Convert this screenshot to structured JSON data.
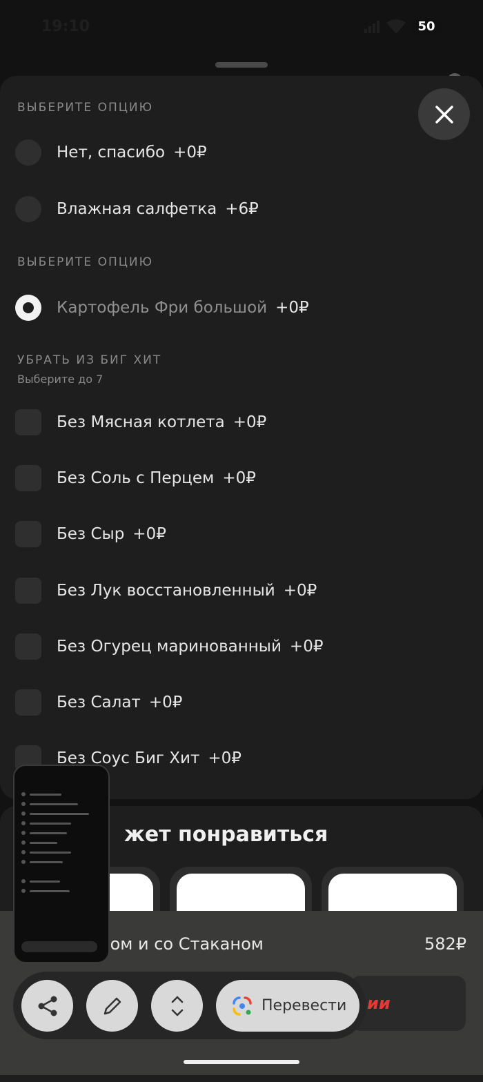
{
  "status_bar": {
    "time": "19:10",
    "battery": "50"
  },
  "sections": [
    {
      "title": "ВЫБЕРИТЕ ОПЦИЮ",
      "items": [
        {
          "label": "Нет, спасибо",
          "price": "+0₽",
          "selected": false
        },
        {
          "label": "Влажная салфетка",
          "price": "+6₽",
          "selected": false
        }
      ]
    },
    {
      "title": "ВЫБЕРИТЕ ОПЦИЮ",
      "items": [
        {
          "label": "Картофель Фри большой",
          "price": "+0₽",
          "selected": true
        }
      ]
    },
    {
      "title": "УБРАТЬ ИЗ БИГ ХИТ",
      "subtitle": "Выберите до 7",
      "items": [
        {
          "label": "Без Мясная котлета",
          "price": "+0₽"
        },
        {
          "label": "Без Соль с Перцем",
          "price": "+0₽"
        },
        {
          "label": "Без Сыр",
          "price": "+0₽"
        },
        {
          "label": "Без Лук восстановленный",
          "price": "+0₽"
        },
        {
          "label": "Без Огурец маринованный",
          "price": "+0₽"
        },
        {
          "label": "Без Салат",
          "price": "+0₽"
        },
        {
          "label": "Без Соус Биг Хит",
          "price": "+0₽"
        }
      ]
    }
  ],
  "recommendations": {
    "title": "жет понравиться"
  },
  "order_bar": {
    "item_name": "итом и со Стаканом",
    "price": "582₽",
    "button_text": "ии"
  },
  "toolbar": {
    "translate_label": "Перевести"
  },
  "colors": {
    "accent_red": "#e53935",
    "sheet_bg": "#1e1e1e"
  }
}
